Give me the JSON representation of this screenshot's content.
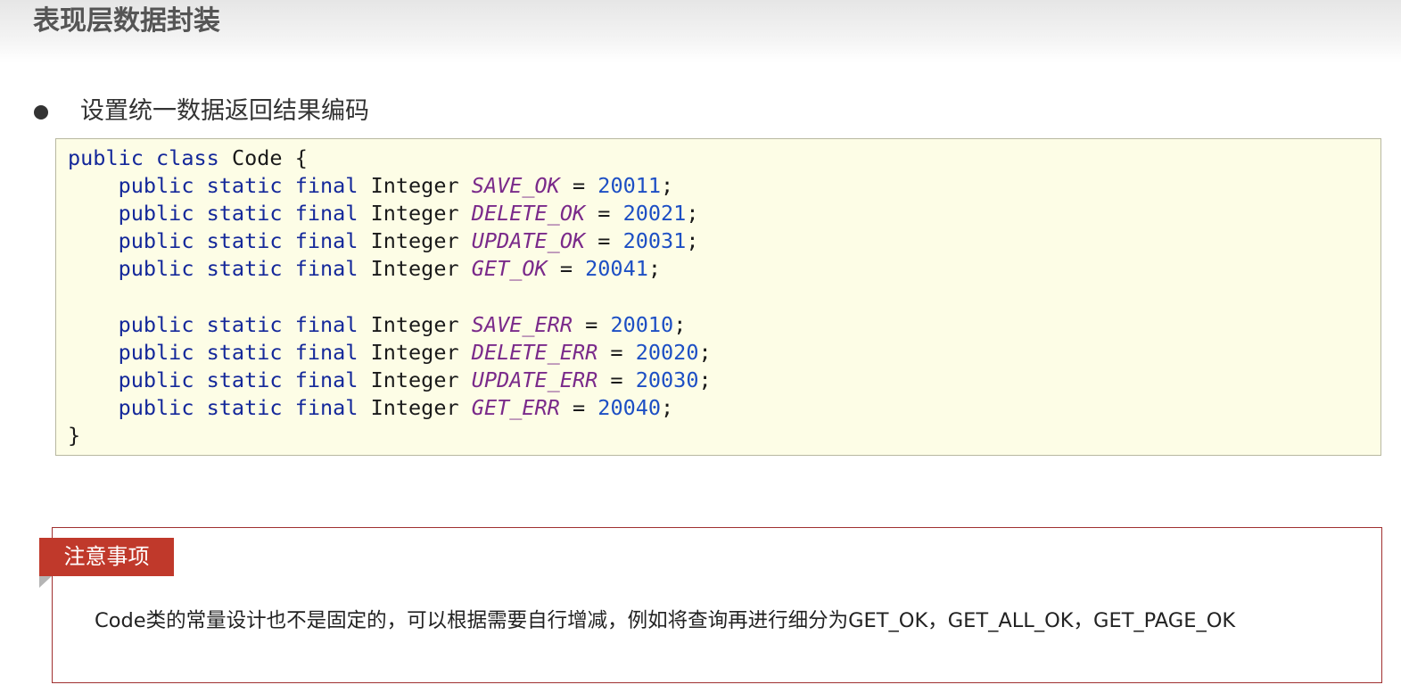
{
  "page": {
    "title": "表现层数据封装"
  },
  "bullet": {
    "text": "设置统一数据返回结果编码"
  },
  "code": {
    "class_decl": {
      "kw1": "public",
      "kw2": "class",
      "name": "Code",
      "open": " {"
    },
    "modifiers": [
      "public",
      "static",
      "final"
    ],
    "type": "Integer",
    "constants_ok": [
      {
        "name": "SAVE_OK",
        "value": "20011"
      },
      {
        "name": "DELETE_OK",
        "value": "20021"
      },
      {
        "name": "UPDATE_OK",
        "value": "20031"
      },
      {
        "name": "GET_OK",
        "value": "20041"
      }
    ],
    "constants_err": [
      {
        "name": "SAVE_ERR",
        "value": "20010"
      },
      {
        "name": "DELETE_ERR",
        "value": "20020"
      },
      {
        "name": "UPDATE_ERR",
        "value": "20030"
      },
      {
        "name": "GET_ERR",
        "value": "20040"
      }
    ],
    "close": "}"
  },
  "note": {
    "tag": "注意事项",
    "text": "Code类的常量设计也不是固定的，可以根据需要自行增减，例如将查询再进行细分为GET_OK，GET_ALL_OK，GET_PAGE_OK"
  }
}
